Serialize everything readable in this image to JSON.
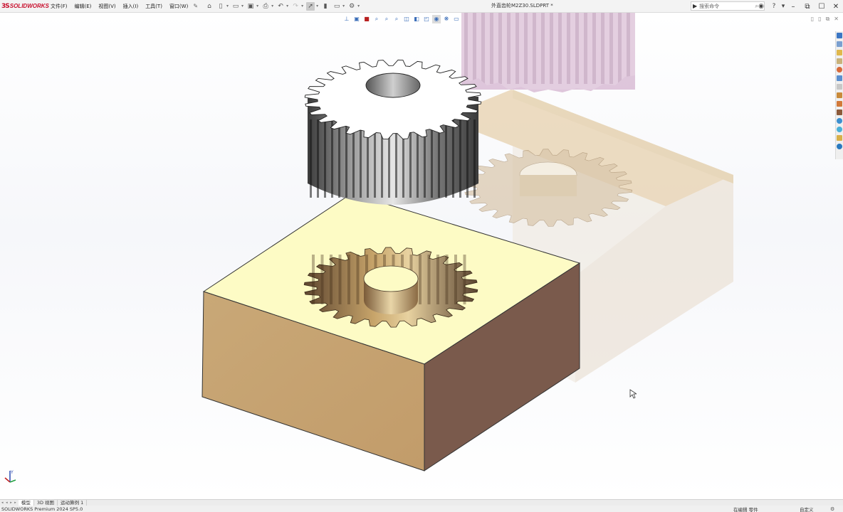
{
  "app": {
    "name": "SOLIDWORKS",
    "logo_mark": "3S"
  },
  "menu": [
    "文件(F)",
    "编辑(E)",
    "视图(V)",
    "插入(I)",
    "工具(T)",
    "窗口(W)"
  ],
  "document": {
    "title": "外直齿轮M2Z30.SLDPRT *"
  },
  "search": {
    "placeholder": "搜索命令"
  },
  "tabs": [
    "模型",
    "3D 视图",
    "运动算例 1"
  ],
  "tab_nav": "◂ ◂ ▸ ▸",
  "status": {
    "product": "SOLIDWORKS Premium 2024 SP5.0",
    "mode": "在编辑 零件",
    "custom": "自定义"
  },
  "colors": {
    "accent": "#c8102e",
    "block_top": "#fdfbc4",
    "block_left": "#c8a574",
    "block_right": "#7a5a4c",
    "gear_face": "#ffffff",
    "gear_teeth": "#6e6e6e",
    "ghost_gear": "#d9b9d4"
  },
  "icons": {
    "home": "home-icon",
    "new": "new-document-icon",
    "open": "open-icon",
    "save": "save-icon",
    "print": "print-icon",
    "undo": "undo-icon",
    "redo": "redo-icon",
    "select": "select-arrow-icon",
    "rebuild": "traffic-light-icon",
    "options": "gear-icon",
    "help": "help-icon",
    "user": "user-icon"
  }
}
